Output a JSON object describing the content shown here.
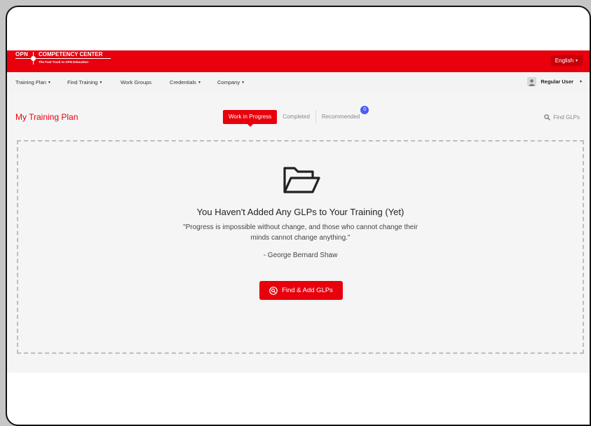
{
  "brand": {
    "abbr": "OPN",
    "name": "COMPETENCY CENTER",
    "tagline": "The Fast Track to OPN Education",
    "color_primary": "#e8000c"
  },
  "header": {
    "language_label": "English"
  },
  "nav": {
    "items": [
      {
        "label": "Training Plan",
        "dropdown": true
      },
      {
        "label": "Find Training",
        "dropdown": true
      },
      {
        "label": "Work Groups",
        "dropdown": false
      },
      {
        "label": "Credentials",
        "dropdown": true
      },
      {
        "label": "Company",
        "dropdown": true
      }
    ],
    "user_name": "Regular User"
  },
  "page": {
    "title": "My Training Plan",
    "tabs": [
      {
        "label": "Work in Progress",
        "active": true
      },
      {
        "label": "Completed",
        "active": false
      },
      {
        "label": "Recommended",
        "active": false,
        "badge": "0"
      }
    ],
    "find_label": "Find GLPs"
  },
  "empty_state": {
    "icon": "folder-open-icon",
    "title": "You Haven't Added Any GLPs to Your Training (Yet)",
    "quote": "\"Progress is impossible without change, and those who cannot change their minds cannot change anything.\"",
    "author": "- George Bernard Shaw",
    "cta_label": "Find & Add GLPs"
  }
}
